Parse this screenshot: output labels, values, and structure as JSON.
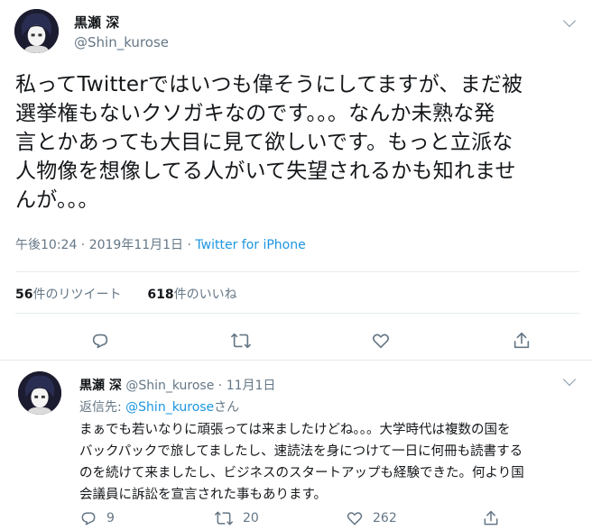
{
  "colors": {
    "accent": "#1b95e0",
    "secondary_text": "#657786",
    "divider": "#e6ecf0"
  },
  "tweet": {
    "avatar_icon": "anime-avatar-icon",
    "name": "黒瀬 深",
    "handle": "@Shin_kurose",
    "text": "私ってTwitterではいつも偉そうにしてますが、まだ被\n選挙権もないクソガキなのです。。。なんか未熟な発\n言とかあっても大目に見て欲しいです。もっと立派な\n人物像を想像してる人がいて失望されるかも知れませ\nんが。。。",
    "time": "午後10:24 · 2019年11月1日",
    "via": "Twitter for iPhone",
    "retweets_count": "56",
    "retweets_label": "件のリツイート",
    "likes_count": "618",
    "likes_label": "件のいいね"
  },
  "actions": [
    {
      "icon": "reply-icon"
    },
    {
      "icon": "retweet-icon"
    },
    {
      "icon": "like-icon"
    },
    {
      "icon": "share-icon"
    }
  ],
  "reply": {
    "name": "黒瀬 深",
    "handle": "@Shin_kurose",
    "date": "11月1日",
    "reply_to_label": "返信先:",
    "reply_to_mention": "@Shin_kurose",
    "reply_to_suffix": "さん",
    "text": "まぁでも若いなりに頑張っては来ましたけどね。。。大学時代は複数の国を\nバックパックで旅してましたし、速読法を身につけて一日に何冊も読書する\nのを続けて来ましたし、ビジネスのスタートアップも経験できた。何より国\n会議員に訴訟を宣言された事もあります。",
    "reply_count": "9",
    "retweet_count": "20",
    "like_count": "262"
  }
}
